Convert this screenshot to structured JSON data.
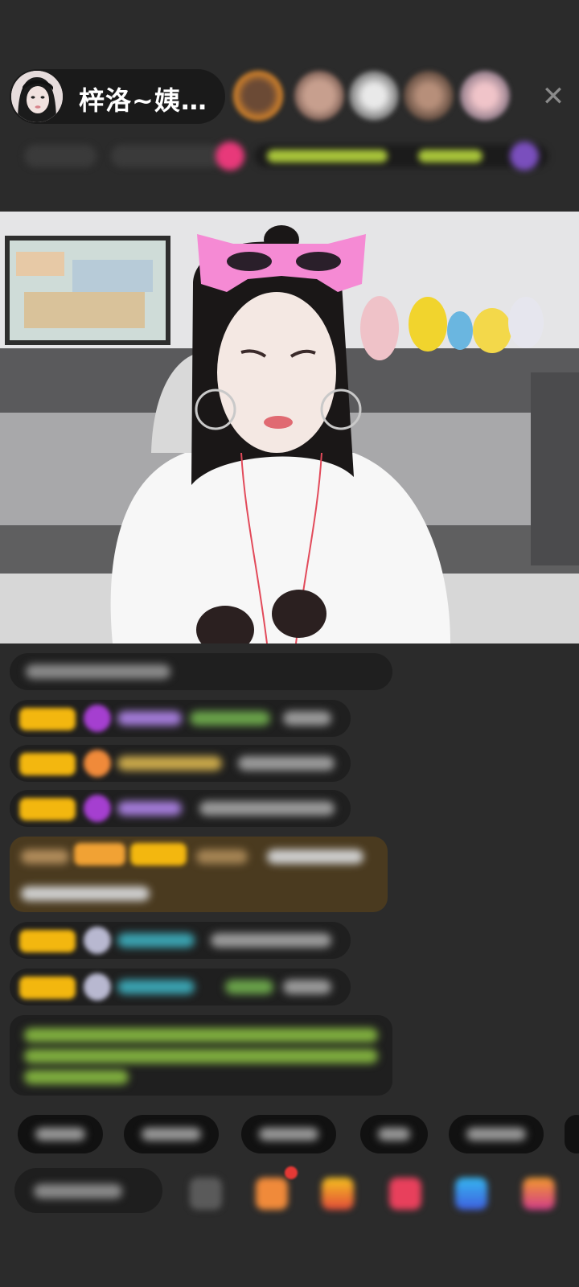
{
  "header": {
    "host_name": "梓洛~姨…",
    "close_symbol": "✕"
  },
  "colors": {
    "background": "#2b2b2b",
    "badge": "#f3b70f",
    "notify_dot": "#e53935"
  }
}
